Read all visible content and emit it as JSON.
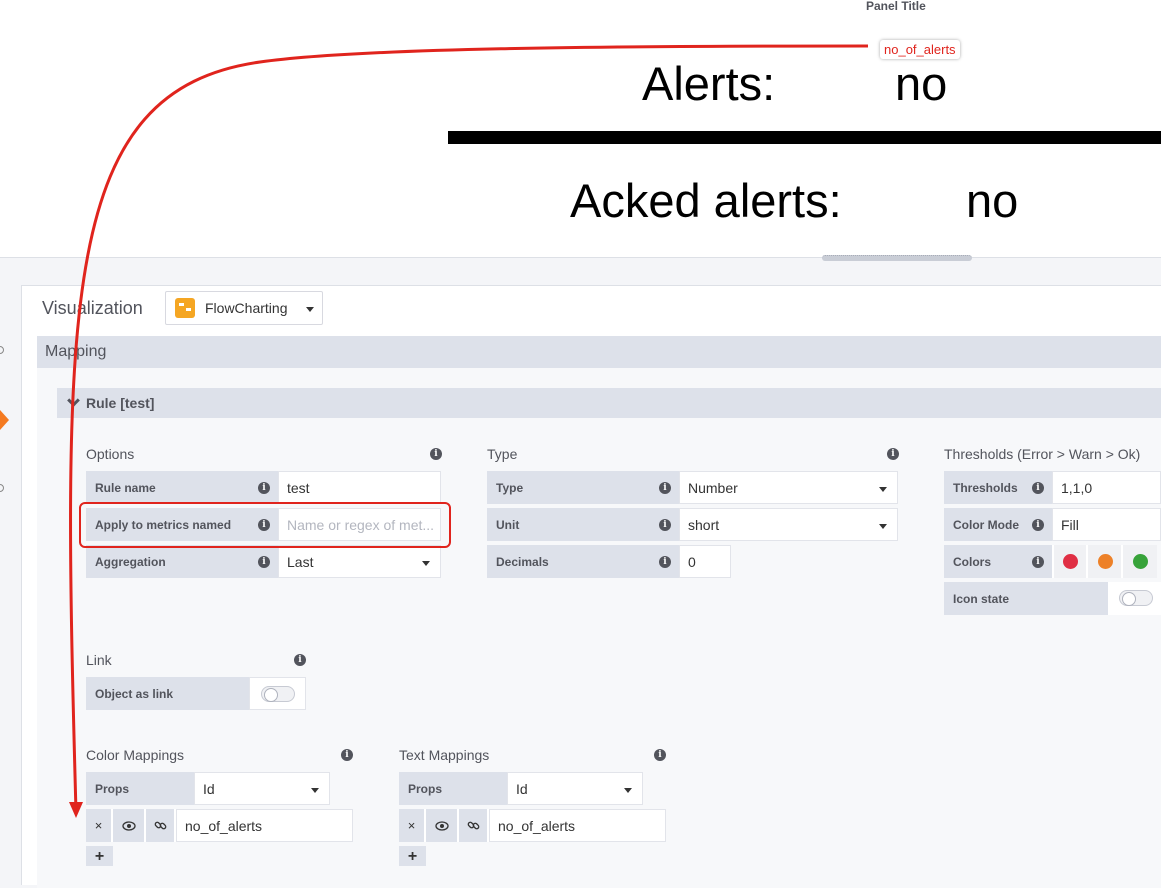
{
  "panel": {
    "title": "Panel Title",
    "alerts_label": "Alerts:",
    "alerts_value": "no",
    "acked_label": "Acked alerts:",
    "acked_value": "no",
    "metric_tag": "no_of_alerts"
  },
  "editor": {
    "visualization_label": "Visualization",
    "visualization_plugin": "FlowCharting",
    "section_title": "Mapping",
    "rule_title": "Rule [test]"
  },
  "options": {
    "title": "Options",
    "rule_name_label": "Rule name",
    "rule_name_value": "test",
    "apply_label": "Apply to metrics named",
    "apply_placeholder": "Name or regex of met...",
    "aggregation_label": "Aggregation",
    "aggregation_value": "Last"
  },
  "type": {
    "title": "Type",
    "type_label": "Type",
    "type_value": "Number",
    "unit_label": "Unit",
    "unit_value": "short",
    "decimals_label": "Decimals",
    "decimals_value": "0"
  },
  "thresholds": {
    "title": "Thresholds (Error > Warn > Ok)",
    "thresholds_label": "Thresholds",
    "thresholds_value": "1,1,0",
    "color_mode_label": "Color Mode",
    "color_mode_value": "Fill",
    "colors_label": "Colors",
    "colors": [
      "#e02f44",
      "#ed8128",
      "#37a33a"
    ],
    "icon_state_label": "Icon state"
  },
  "link": {
    "title": "Link",
    "object_as_link_label": "Object as link"
  },
  "color_mappings": {
    "title": "Color Mappings",
    "props_label": "Props",
    "props_value": "Id",
    "mapping_value": "no_of_alerts"
  },
  "text_mappings": {
    "title": "Text Mappings",
    "props_label": "Props",
    "props_value": "Id",
    "mapping_value": "no_of_alerts"
  },
  "icons": {
    "delete": "×",
    "eye": "👁",
    "link": "🔗",
    "add": "+",
    "info": "i"
  },
  "annotation_color": "#e0241d",
  "accent_orange": "#f47a21"
}
